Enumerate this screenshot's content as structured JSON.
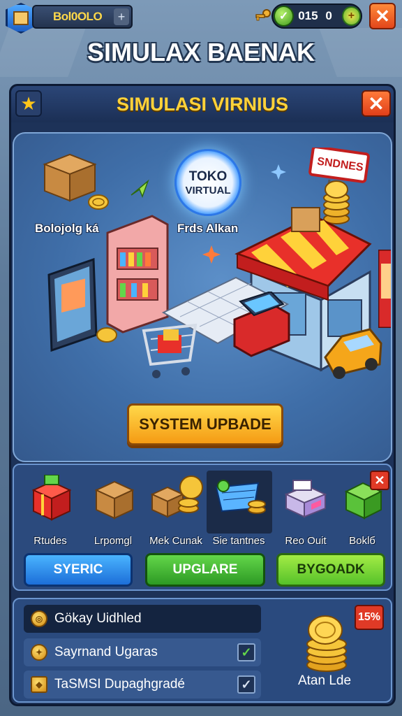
{
  "topbar": {
    "currency_value": "Bol0OLO",
    "currency_plus": "+",
    "gem_value": "015",
    "gem_zero": "0",
    "gem_add": "+",
    "close_label": "✕"
  },
  "title": "SIMULAX BAENAK",
  "panel": {
    "title": "SIMULASI VIRNIUS",
    "close_label": "✕",
    "star_icon": "★"
  },
  "scene": {
    "toko_line1": "TOKO",
    "toko_line2": "VIRTUAL",
    "label_left": "Bolojolg ká",
    "label_mid": "Frds Alkan",
    "shop_sign": "SNDNES",
    "upgrade_button": "SYSTEM UPBADE"
  },
  "items": [
    {
      "label": "Rtudes",
      "icon": "gift-box-icon"
    },
    {
      "label": "Lrpomgl",
      "icon": "cardboard-box-icon"
    },
    {
      "label": "Mek Cunak",
      "icon": "boxes-coins-icon"
    },
    {
      "label": "Sie tantnes",
      "icon": "cart-coins-icon",
      "selected": true
    },
    {
      "label": "Reo Ouit",
      "icon": "printer-icon"
    },
    {
      "label": "Boklб",
      "icon": "green-box-icon"
    }
  ],
  "items_close": "✕",
  "actions": {
    "blue": "SYERIC",
    "green": "UPGLARE",
    "lime": "BYGOADK"
  },
  "tasks": [
    {
      "text": "Gökay Uidhled",
      "checked": false
    },
    {
      "text": "Sayrnand Ugaras",
      "checked": true
    },
    {
      "text": "TaSMSI Dupaghgradé",
      "checked": true
    }
  ],
  "percent_badge": "15%",
  "reward_label": "Atan Lde",
  "colors": {
    "accent_gold": "#ffd23a",
    "panel_navy": "#1d3258",
    "close_red": "#e03f1a"
  }
}
